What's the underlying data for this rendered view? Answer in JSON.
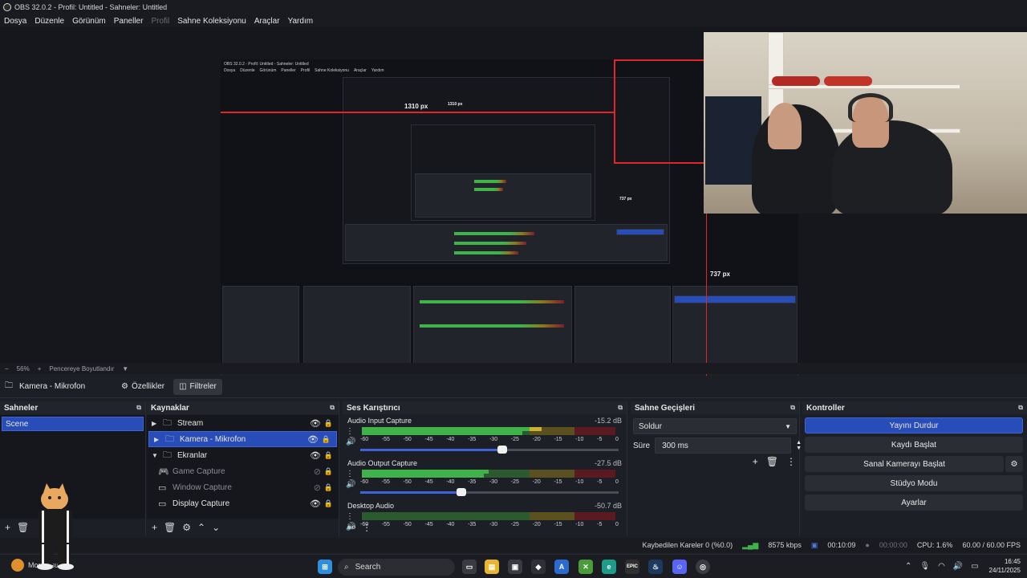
{
  "window": {
    "title": "OBS 32.0.2 - Profil: Untitled - Sahneler: Untitled"
  },
  "menu": [
    "Dosya",
    "Düzenle",
    "Görünüm",
    "Paneller",
    "Profil",
    "Sahne Koleksiyonu",
    "Araçlar",
    "Yardım"
  ],
  "menu_disabled": "Profil",
  "preview": {
    "measure_width": "1310 px",
    "measure_width_small": "1310 px",
    "measure_height": "737 px",
    "measure_height_small": "737 px",
    "mini_title": "OBS 32.0.2 - Profil: Untitled - Sahneler: Untitled",
    "mini_menu": [
      "Dosya",
      "Düzenle",
      "Görünüm",
      "Paneller",
      "Profil",
      "Sahne Koleksiyonu",
      "Araçlar",
      "Yardım"
    ],
    "zoom": "56%",
    "fit_label": "Pencereye Boyutlandır"
  },
  "context_bar": {
    "source": "Kamera - Mikrofon",
    "properties": "Özellikler",
    "filters": "Filtreler"
  },
  "scenes": {
    "title": "Sahneler",
    "items": [
      "Scene"
    ]
  },
  "sources": {
    "title": "Kaynaklar",
    "items": [
      {
        "label": "Stream",
        "type": "folder",
        "arrow": "▶",
        "visible": true,
        "selected": false,
        "dim": false
      },
      {
        "label": "Kamera - Mikrofon",
        "type": "folder",
        "arrow": "▶",
        "visible": true,
        "selected": true,
        "dim": false
      },
      {
        "label": "Ekranlar",
        "type": "folder",
        "arrow": "▼",
        "visible": true,
        "selected": false,
        "dim": false
      },
      {
        "label": "Game Capture",
        "type": "game",
        "arrow": "",
        "visible": false,
        "selected": false,
        "dim": true
      },
      {
        "label": "Window Capture",
        "type": "window",
        "arrow": "",
        "visible": false,
        "selected": false,
        "dim": true
      },
      {
        "label": "Display Capture",
        "type": "display",
        "arrow": "",
        "visible": true,
        "selected": false,
        "dim": false
      }
    ]
  },
  "mixer": {
    "title": "Ses Karıştırıcı",
    "ticks": [
      "-60",
      "-55",
      "-50",
      "-45",
      "-40",
      "-35",
      "-30",
      "-25",
      "-20",
      "-15",
      "-10",
      "-5",
      "0"
    ],
    "channels": [
      {
        "name": "Audio Input Capture",
        "db": "-15.2 dB",
        "level": 0.71,
        "volume": 0.55
      },
      {
        "name": "Audio Output Capture",
        "db": "-27.5 dB",
        "level": 0.5,
        "volume": 0.39
      },
      {
        "name": "Desktop Audio",
        "db": "-50.7 dB",
        "level": 0.0,
        "volume": 0.0
      }
    ]
  },
  "transitions": {
    "title": "Sahne Geçişleri",
    "selected": "Soldur",
    "duration_label": "Süre",
    "duration_value": "300 ms"
  },
  "controls": {
    "title": "Kontroller",
    "stop_stream": "Yayını Durdur",
    "start_recording": "Kaydı Başlat",
    "virtual_camera": "Sanal Kamerayı Başlat",
    "studio_mode": "Stüdyo Modu",
    "settings": "Ayarlar"
  },
  "status": {
    "dropped_frames": "Kaybedilen Kareler 0 (%0.0)",
    "bitrate": "8575 kbps",
    "stream_time": "00:10:09",
    "record_time": "00:00:00",
    "cpu": "CPU: 1.6%",
    "fps": "60.00 / 60.00 FPS"
  },
  "taskbar": {
    "search": "Search",
    "time": "16:45",
    "date": "24/11/2025",
    "weather": "Mostly sunny"
  },
  "colors": {
    "accent": "#284cb8",
    "meter_green": "#3fb24a",
    "meter_yellow": "#8a7a21",
    "meter_red": "#7e1f28",
    "measure_line": "#e02626"
  }
}
